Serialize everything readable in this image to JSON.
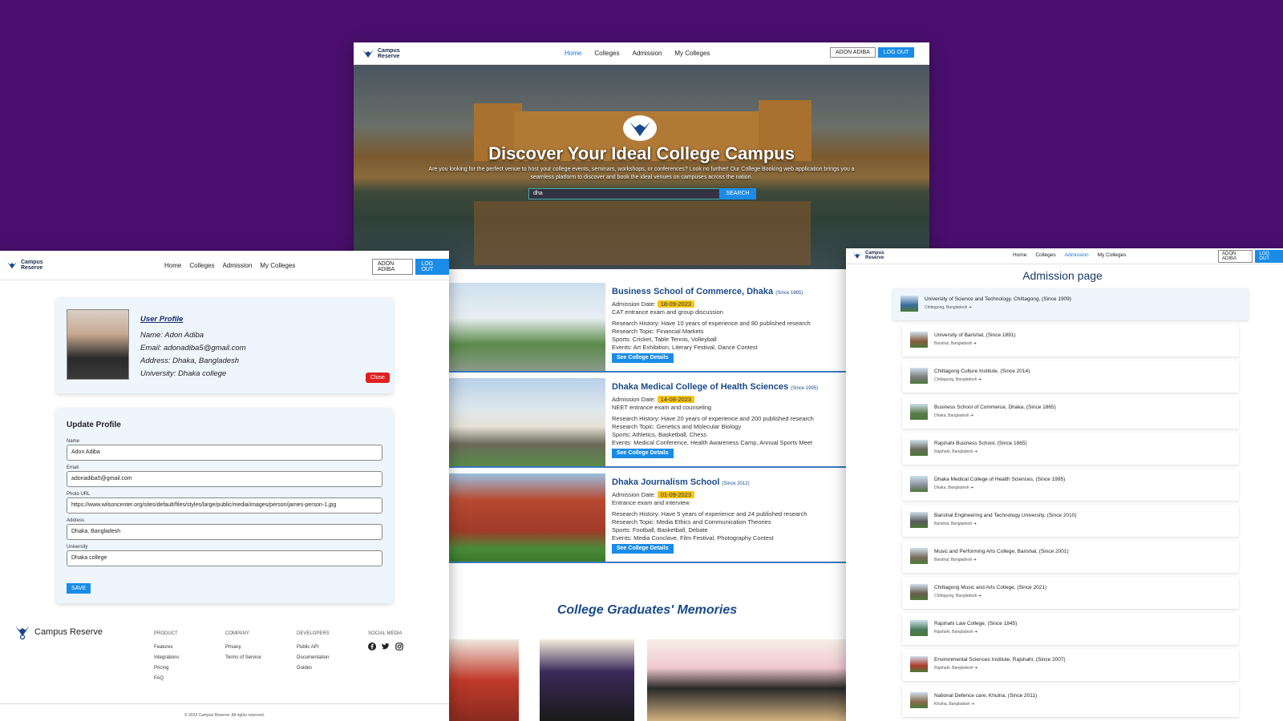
{
  "brand": {
    "name_line1": "Campus",
    "name_line2": "Reserve",
    "full": "Campus Reserve"
  },
  "nav": {
    "links": [
      "Home",
      "Colleges",
      "Admission",
      "My Colleges"
    ],
    "user_button": "ADON ADIBA",
    "logout_button": "LOG OUT"
  },
  "hero": {
    "title": "Discover Your Ideal College Campus",
    "subtitle": "Are you looking for the perfect venue to host your college events, seminars, workshops, or conferences? Look no further! Our College Booking web application brings you a seamless platform to discover and book the ideal venues on campuses across the nation.",
    "search_value": "dha",
    "search_button": "SEARCH"
  },
  "colleges": [
    {
      "name": "Business School of Commerce, Dhaka",
      "since": "(Since 1865)",
      "date_label": "Admission Date:",
      "date": "18-09-2023",
      "process": "CAT entrance exam and group discussion",
      "research": "Research History: Have 10 years of experience and 80 published research",
      "topic": "Research Topic: Financial Markets",
      "sports": "Sports: Cricket, Table Tennis, Volleyball",
      "events": "Events: Art Exhibition, Literary Festival, Dance Contest",
      "button": "See College Details"
    },
    {
      "name": "Dhaka Medical College of Health Sciences",
      "since": "(Since 1995)",
      "date_label": "Admission Date:",
      "date": "14-08-2023",
      "process": "NEET entrance exam and counseling",
      "research": "Research History: Have 20 years of experience and 200 published research",
      "topic": "Research Topic: Genetics and Molecular Biology",
      "sports": "Sports: Athletics, Basketball, Chess",
      "events": "Events: Medical Conference, Health Awareness Camp, Annual Sports Meet",
      "button": "See College Details"
    },
    {
      "name": "Dhaka Journalism School",
      "since": "(Since 2012)",
      "date_label": "Admission Date:",
      "date": "01-09-2023",
      "process": "Entrance exam and interview",
      "research": "Research History: Have 5 years of experience and 24 published research",
      "topic": "Research Topic: Media Ethics and Communication Theories",
      "sports": "Sports: Football, Basketball, Debate",
      "events": "Events: Media Conclave, Film Festival, Photography Contest",
      "button": "See College Details"
    }
  ],
  "memories_title": "College Graduates' Memories",
  "profile": {
    "heading": "User Profile",
    "name": "Name: Adon Adiba",
    "email": "Email: adonadiba5@gmail.com",
    "address": "Address: Dhaka, Bangladesh",
    "university": "University: Dhaka college",
    "close_button": "Close"
  },
  "update_form": {
    "heading": "Update Profile",
    "fields": [
      {
        "label": "Name",
        "value": "Adon Adiba"
      },
      {
        "label": "Email",
        "value": "adonadiba5@gmail.com"
      },
      {
        "label": "Photo URL",
        "value": "https://www.wilsoncenter.org/sites/default/files/styles/large/public/media/images/person/james-person-1.jpg"
      },
      {
        "label": "Address",
        "value": "Dhaka, Bangladesh"
      },
      {
        "label": "University",
        "value": "Dhaka college"
      }
    ],
    "save_button": "SAVE"
  },
  "footer": {
    "product": {
      "title": "PRODUCT",
      "items": [
        "Features",
        "Integrations",
        "Pricing",
        "FAQ"
      ]
    },
    "company": {
      "title": "COMPANY",
      "items": [
        "Privacy",
        "Terms of Service"
      ]
    },
    "developers": {
      "title": "DEVELOPERS",
      "items": [
        "Public API",
        "Documentation",
        "Guides"
      ]
    },
    "social": {
      "title": "SOCIAL MEDIA",
      "icons": [
        "facebook-icon",
        "twitter-icon",
        "instagram-icon"
      ]
    },
    "copyright": "© 2023 Campus Reserve. All rights reserved."
  },
  "admission": {
    "title": "Admission page",
    "items": [
      {
        "name": "University of Science and Technology, Chittagong, (Since 1909)",
        "location": "Chittagong, Bangladesh"
      },
      {
        "name": "University of Barishal, (Since 1891)",
        "location": "Barishal, Bangladesh"
      },
      {
        "name": "Chittagong Culture Institute, (Since 2014)",
        "location": "Chittagong, Bangladesh"
      },
      {
        "name": "Business School of Commerce, Dhaka, (Since 1865)",
        "location": "Dhaka, Bangladesh"
      },
      {
        "name": "Rajshahi Business School, (Since 1865)",
        "location": "Rajshahi, Bangladesh"
      },
      {
        "name": "Dhaka Medical College of Health Sciences, (Since 1995)",
        "location": "Dhaka, Bangladesh"
      },
      {
        "name": "Barishal Engineering and Technology University, (Since 2010)",
        "location": "Barishal, Bangladesh"
      },
      {
        "name": "Music and Performing Arts College, Barishal, (Since 2001)",
        "location": "Barishal, Bangladesh"
      },
      {
        "name": "Chittagong Music and Arts College, (Since 2021)",
        "location": "Chittagong, Bangladesh"
      },
      {
        "name": "Rajshahi Law College, (Since 1845)",
        "location": "Rajshahi, Bangladesh"
      },
      {
        "name": "Environmental Sciences Institute, Rajshahi, (Since 2007)",
        "location": "Rajshahi, Bangladesh"
      },
      {
        "name": "National Defence care, Khulna, (Since 2011)",
        "location": "Khulna, Bangladesh"
      }
    ]
  },
  "colors": {
    "background": "#4a0f6e",
    "accent": "#1a8ce8",
    "title": "#1a4a8a",
    "date_badge": "#f5c518",
    "close": "#e02020"
  }
}
